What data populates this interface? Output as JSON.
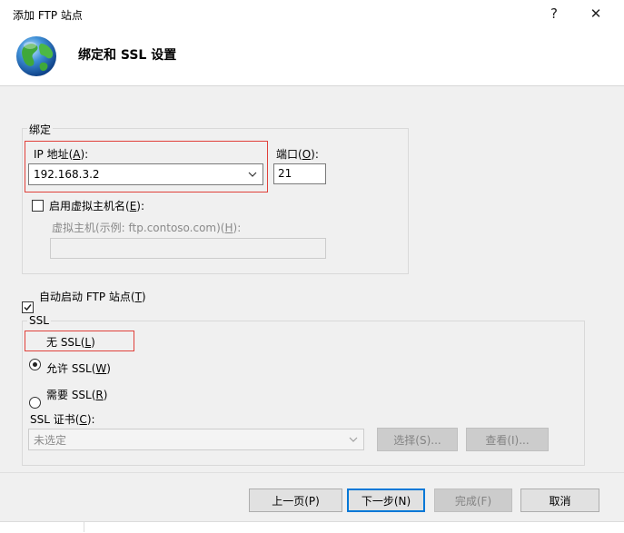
{
  "window": {
    "title": "添加 FTP 站点",
    "help_label": "?",
    "close_label": "✕"
  },
  "header": {
    "title": "绑定和 SSL 设置",
    "icon": "globe-icon"
  },
  "binding": {
    "group_label": "绑定",
    "ip_label": "IP 地址(",
    "ip_key": "A",
    "ip_suffix": "):",
    "ip_value": "192.168.3.2",
    "port_label": "端口(",
    "port_key": "O",
    "port_suffix": "):",
    "port_value": "21",
    "virtual_host_checkbox_label": "启用虚拟主机名(",
    "virtual_host_key": "E",
    "virtual_host_suffix": "):",
    "virtual_host_checked": false,
    "virtual_host_field_label": "虚拟主机(示例: ftp.contoso.com)(",
    "virtual_host_field_key": "H",
    "virtual_host_field_suffix": "):",
    "virtual_host_value": ""
  },
  "autostart": {
    "label": "自动启动 FTP 站点(",
    "key": "T",
    "suffix": ")",
    "checked": true
  },
  "ssl": {
    "group_label": "SSL",
    "options": [
      {
        "label": "无 SSL(",
        "key": "L",
        "suffix": ")",
        "selected": true
      },
      {
        "label": "允许 SSL(",
        "key": "W",
        "suffix": ")",
        "selected": false
      },
      {
        "label": "需要 SSL(",
        "key": "R",
        "suffix": ")",
        "selected": false
      }
    ],
    "cert_label": "SSL 证书(",
    "cert_key": "C",
    "cert_suffix": "):",
    "cert_value": "未选定",
    "select_button": "选择(S)...",
    "view_button": "查看(I)..."
  },
  "buttons": {
    "prev": "上一页(P)",
    "next": "下一步(N)",
    "finish": "完成(F)",
    "cancel": "取消"
  },
  "colors": {
    "highlight_border": "#e0403a",
    "default_button_border": "#0078d7",
    "dialog_background": "#f0f0f0"
  }
}
